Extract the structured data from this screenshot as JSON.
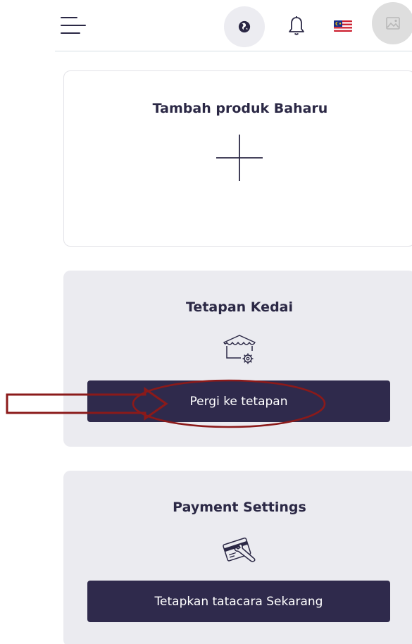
{
  "header": {
    "menu_icon": "hamburger-menu-icon",
    "language_icon": "globe-icon",
    "notification_icon": "bell-icon",
    "flag_icon": "malaysia-flag-icon",
    "avatar_icon": "image-placeholder-icon"
  },
  "cards": {
    "add_product": {
      "title": "Tambah produk Baharu",
      "icon": "plus-icon"
    },
    "shop_settings": {
      "title": "Tetapan Kedai",
      "icon": "shop-settings-icon",
      "button_label": "Pergi ke tetapan"
    },
    "payment_settings": {
      "title": "Payment Settings",
      "icon": "credit-card-wrench-icon",
      "button_label": "Tetapkan tatacara Sekarang"
    }
  },
  "colors": {
    "primary": "#2f2a4c",
    "card_bg": "#ebebf0",
    "annotation": "#8b1a1a"
  }
}
